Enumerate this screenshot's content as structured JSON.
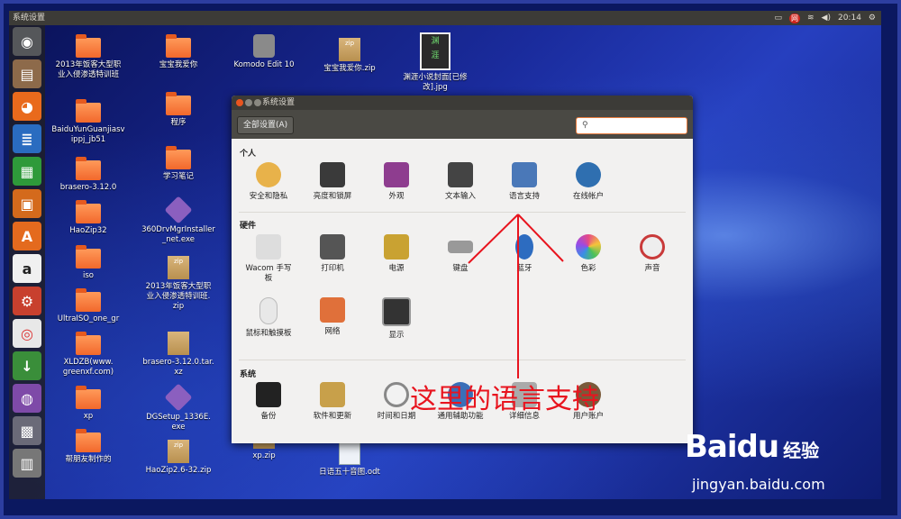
{
  "top_bar": {
    "title": "系统设置",
    "clock": "20:14",
    "tray_icons": [
      "keyboard-icon",
      "netease-music-icon",
      "wifi-icon",
      "volume-icon",
      "settings-gear-icon"
    ],
    "volume_label": "◀)",
    "net_label": "网"
  },
  "launcher": {
    "items": [
      "ubuntu-dash-icon",
      "file-manager-icon",
      "firefox-icon",
      "writer-icon",
      "calc-icon",
      "impress-icon",
      "software-center-icon",
      "amazon-icon",
      "system-settings-icon",
      "chrome-icon",
      "download-icon",
      "disc-icon",
      "workspace-icon",
      "trash-icon"
    ]
  },
  "desktop": {
    "icons": [
      {
        "label": "2013年饭客大型职\n业入侵渗透特训班",
        "type": "folder"
      },
      {
        "label": "BaiduYunGuanjiasv\nippj_jb51",
        "type": "folder"
      },
      {
        "label": "brasero-3.12.0",
        "type": "folder"
      },
      {
        "label": "HaoZip32",
        "type": "folder"
      },
      {
        "label": "iso",
        "type": "folder"
      },
      {
        "label": "UltraISO_one_gr",
        "type": "folder"
      },
      {
        "label": "XLDZB(www.\ngreenxf.com)",
        "type": "folder"
      },
      {
        "label": "xp",
        "type": "folder"
      },
      {
        "label": "帮朋友制作的",
        "type": "folder"
      },
      {
        "label": "宝宝我爱你",
        "type": "folder"
      },
      {
        "label": "程序",
        "type": "folder"
      },
      {
        "label": "学习笔记",
        "type": "folder"
      },
      {
        "label": "360DrvMgrInstaller\n_net.exe",
        "type": "gem"
      },
      {
        "label": "2013年饭客大型职\n业入侵渗透特训班.\nzip",
        "type": "zip"
      },
      {
        "label": "brasero-3.12.0.tar.\nxz",
        "type": "zip"
      },
      {
        "label": "DGSetup_1336E.\nexe",
        "type": "gem"
      },
      {
        "label": "HaoZip2.6-32.zip",
        "type": "zip"
      },
      {
        "label": "Komodo Edit 10",
        "type": "komodo"
      },
      {
        "label": "宝宝我爱你.zip",
        "type": "zip"
      },
      {
        "label": "渊涯小说封面[已修\n改].jpg",
        "type": "image"
      },
      {
        "label": "xp.zip",
        "type": "zip"
      },
      {
        "label": "日语五十音图.odt",
        "type": "doc"
      }
    ],
    "zip_tag": "zip",
    "image_text": "渊\n涯"
  },
  "settings_window": {
    "title": "系统设置",
    "all_settings_label": "全部设置(A)",
    "search_value": "",
    "search_placeholder": "",
    "sections": [
      {
        "label": "个人",
        "items": [
          {
            "label": "安全和隐私",
            "icon": "security-privacy-icon",
            "color": "#e8b24a"
          },
          {
            "label": "亮度和锁屏",
            "icon": "brightness-lock-icon",
            "color": "#3a3a3a"
          },
          {
            "label": "外观",
            "icon": "appearance-icon",
            "color": "#8e3d8f"
          },
          {
            "label": "文本输入",
            "icon": "text-entry-icon",
            "color": "#444"
          },
          {
            "label": "语言支持",
            "icon": "language-support-icon",
            "color": "#4a78b8"
          },
          {
            "label": "在线帐户",
            "icon": "online-accounts-icon",
            "color": "#2f6fb0"
          }
        ]
      },
      {
        "label": "硬件",
        "items": [
          {
            "label": "Wacom 手写\n板",
            "icon": "wacom-tablet-icon",
            "color": "#bbb"
          },
          {
            "label": "打印机",
            "icon": "printer-icon",
            "color": "#555"
          },
          {
            "label": "电源",
            "icon": "power-icon",
            "color": "#c9a232"
          },
          {
            "label": "键盘",
            "icon": "keyboard-icon",
            "color": "#999"
          },
          {
            "label": "蓝牙",
            "icon": "bluetooth-icon",
            "color": "#2d6cc0"
          },
          {
            "label": "色彩",
            "icon": "color-icon",
            "color": "#e64a86"
          },
          {
            "label": "声音",
            "icon": "sound-icon",
            "color": "#c93a3a"
          },
          {
            "label": "鼠标和触摸板",
            "icon": "mouse-touchpad-icon",
            "color": "#ddd"
          },
          {
            "label": "网络",
            "icon": "network-icon",
            "color": "#e0703a"
          },
          {
            "label": "显示",
            "icon": "display-icon",
            "color": "#333"
          }
        ]
      },
      {
        "label": "系统",
        "items": [
          {
            "label": "备份",
            "icon": "backup-icon",
            "color": "#222"
          },
          {
            "label": "软件和更新",
            "icon": "software-updates-icon",
            "color": "#c8a04a"
          },
          {
            "label": "时间和日期",
            "icon": "time-date-icon",
            "color": "#888"
          },
          {
            "label": "通用辅助功能",
            "icon": "universal-access-icon",
            "color": "#3a6fb8"
          },
          {
            "label": "详细信息",
            "icon": "details-icon",
            "color": "#aaa"
          },
          {
            "label": "用户账户",
            "icon": "user-accounts-icon",
            "color": "#7a5a3a"
          }
        ]
      }
    ]
  },
  "annotation": {
    "text": "这里的语言支持",
    "color": "#e8141e"
  },
  "watermark": {
    "brand": "Bai",
    "paw": "du",
    "suffix": "经验",
    "url": "jingyan.baidu.com"
  }
}
